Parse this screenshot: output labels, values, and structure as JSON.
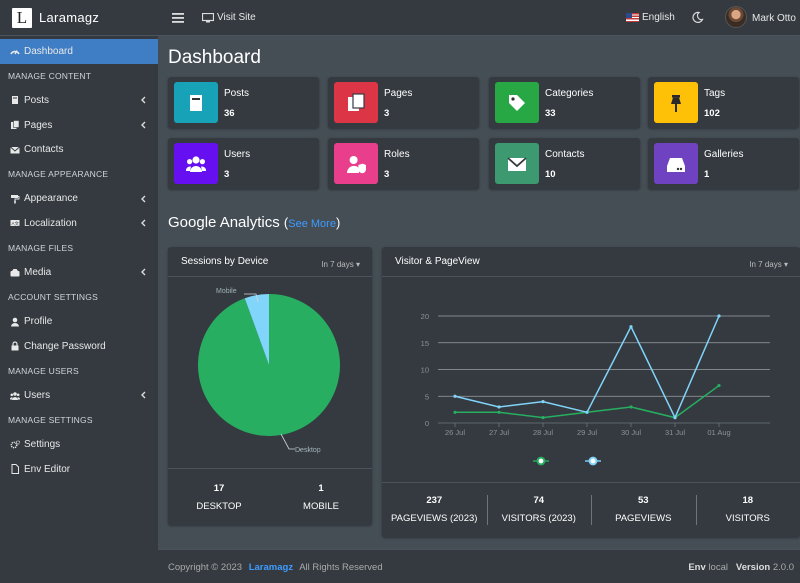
{
  "brand": {
    "logo_letter": "L",
    "name": "Laramagz"
  },
  "sidebar": {
    "items": [
      {
        "type": "item",
        "label": "Dashboard",
        "icon": "tachometer-icon",
        "active": true
      },
      {
        "type": "header",
        "label": "MANAGE CONTENT"
      },
      {
        "type": "item",
        "label": "Posts",
        "icon": "book-icon",
        "chevron": true
      },
      {
        "type": "item",
        "label": "Pages",
        "icon": "copy-icon",
        "chevron": true
      },
      {
        "type": "item",
        "label": "Contacts",
        "icon": "envelope-icon"
      },
      {
        "type": "header",
        "label": "MANAGE APPEARANCE"
      },
      {
        "type": "item",
        "label": "Appearance",
        "icon": "paint-roller-icon",
        "chevron": true
      },
      {
        "type": "item",
        "label": "Localization",
        "icon": "language-icon",
        "chevron": true
      },
      {
        "type": "header",
        "label": "MANAGE FILES"
      },
      {
        "type": "item",
        "label": "Media",
        "icon": "photo-icon",
        "chevron": true
      },
      {
        "type": "header",
        "label": "ACCOUNT SETTINGS"
      },
      {
        "type": "item",
        "label": "Profile",
        "icon": "user-icon"
      },
      {
        "type": "item",
        "label": "Change Password",
        "icon": "lock-icon"
      },
      {
        "type": "header",
        "label": "MANAGE USERS"
      },
      {
        "type": "item",
        "label": "Users",
        "icon": "users-icon",
        "chevron": true
      },
      {
        "type": "header",
        "label": "MANAGE SETTINGS"
      },
      {
        "type": "item",
        "label": "Settings",
        "icon": "cogs-icon"
      },
      {
        "type": "item",
        "label": "Env Editor",
        "icon": "file-icon"
      }
    ]
  },
  "topbar": {
    "visit_label": "Visit Site",
    "language": "English",
    "user_name": "Mark Otto"
  },
  "page": {
    "title": "Dashboard"
  },
  "info_boxes": [
    {
      "label": "Posts",
      "value": "36",
      "color": "#17a2b8",
      "icon": "book-icon"
    },
    {
      "label": "Pages",
      "value": "3",
      "color": "#dc3545",
      "icon": "copy-icon"
    },
    {
      "label": "Categories",
      "value": "33",
      "color": "#28a745",
      "icon": "tags-icon"
    },
    {
      "label": "Tags",
      "value": "102",
      "color": "#ffc107",
      "icon": "thumbtack-icon"
    },
    {
      "label": "Users",
      "value": "3",
      "color": "#6610f2",
      "icon": "users-icon"
    },
    {
      "label": "Roles",
      "value": "3",
      "color": "#e83e8c",
      "icon": "user-shield-icon"
    },
    {
      "label": "Contacts",
      "value": "10",
      "color": "#3d9970",
      "icon": "envelope-icon"
    },
    {
      "label": "Galleries",
      "value": "1",
      "color": "#6f42c1",
      "icon": "hdd-icon"
    }
  ],
  "analytics": {
    "title": "Google Analytics",
    "see_more": "See More"
  },
  "sessions_card": {
    "title": "Sessions by Device",
    "range": "In 7 days",
    "stats": [
      {
        "value": "17",
        "label": "DESKTOP"
      },
      {
        "value": "1",
        "label": "MOBILE"
      }
    ]
  },
  "visitor_card": {
    "title": "Visitor & PageView",
    "range": "In 7 days",
    "stats": [
      {
        "value": "237",
        "label": "PAGEVIEWS (2023)"
      },
      {
        "value": "74",
        "label": "VISITORS (2023)"
      },
      {
        "value": "53",
        "label": "PAGEVIEWS"
      },
      {
        "value": "18",
        "label": "VISITORS"
      }
    ]
  },
  "chart_data": [
    {
      "type": "pie",
      "labels": [
        "Desktop",
        "Mobile"
      ],
      "values": [
        17,
        1
      ],
      "colors": [
        "#27ae60",
        "#81d4fa"
      ]
    },
    {
      "type": "line",
      "categories": [
        "26 Jul",
        "27 Jul",
        "28 Jul",
        "29 Jul",
        "30 Jul",
        "31 Jul",
        "01 Aug"
      ],
      "ylim": [
        0,
        20
      ],
      "yticks": [
        0,
        5,
        10,
        15,
        20
      ],
      "grid": true,
      "series": [
        {
          "values": [
            5,
            3,
            4,
            2,
            18,
            1,
            20
          ],
          "color": "#81d4fa"
        },
        {
          "values": [
            2,
            2,
            1,
            2,
            3,
            1,
            7
          ],
          "color": "#27ae60"
        }
      ]
    }
  ],
  "footer": {
    "copyright": "Copyright © 2023",
    "brand_link": "Laramagz",
    "rights": "All Rights Reserved",
    "env_label": "Env",
    "env_value": "local",
    "version_label": "Version",
    "version_value": "2.0.0"
  }
}
